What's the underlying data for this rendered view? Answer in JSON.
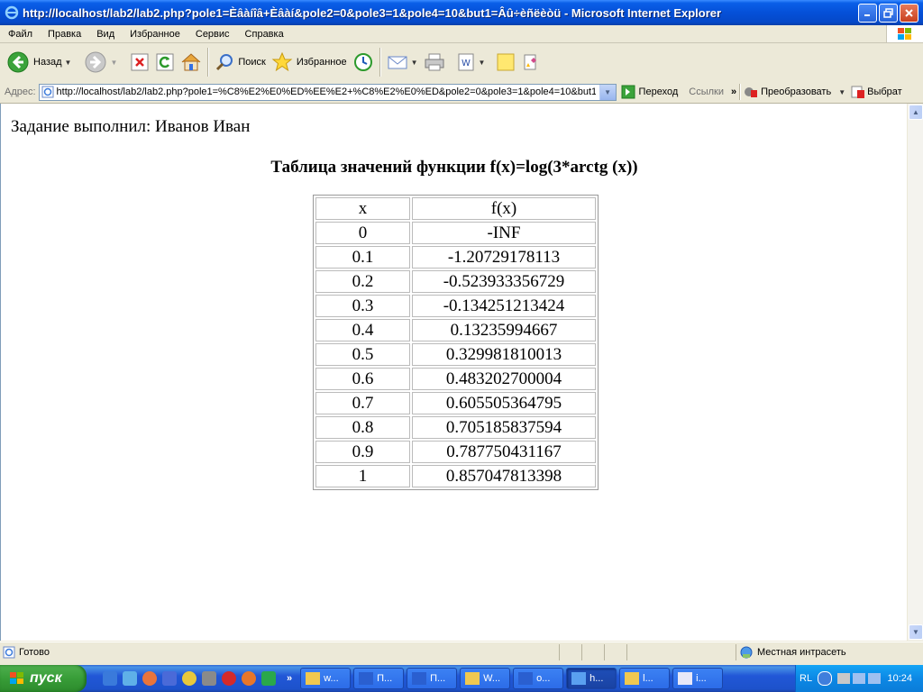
{
  "window": {
    "title": "http://localhost/lab2/lab2.php?pole1=Èâàíîâ+Èâàí&pole2=0&pole3=1&pole4=10&but1=Âû÷èñëèòü - Microsoft Internet Explorer"
  },
  "menu": {
    "items": [
      "Файл",
      "Правка",
      "Вид",
      "Избранное",
      "Сервис",
      "Справка"
    ]
  },
  "toolbar": {
    "back_label": "Назад",
    "search_label": "Поиск",
    "favorites_label": "Избранное"
  },
  "address": {
    "label": "Адрес:",
    "url": "http://localhost/lab2/lab2.php?pole1=%C8%E2%E0%ED%EE%E2+%C8%E2%E0%ED&pole2=0&pole3=1&pole4=10&but1",
    "go_label": "Переход",
    "links_label": "Ссылки",
    "convert_label": "Преобразовать",
    "select_label": "Выбрат"
  },
  "page": {
    "author": "Задание выполнил: Иванов Иван",
    "heading": "Таблица значений функции f(x)=log(3*arctg (x))",
    "table": {
      "headers": [
        "x",
        "f(x)"
      ],
      "rows": [
        [
          "0",
          "-INF"
        ],
        [
          "0.1",
          "-1.20729178113"
        ],
        [
          "0.2",
          "-0.523933356729"
        ],
        [
          "0.3",
          "-0.134251213424"
        ],
        [
          "0.4",
          "0.13235994667"
        ],
        [
          "0.5",
          "0.329981810013"
        ],
        [
          "0.6",
          "0.483202700004"
        ],
        [
          "0.7",
          "0.605505364795"
        ],
        [
          "0.8",
          "0.705185837594"
        ],
        [
          "0.9",
          "0.787750431167"
        ],
        [
          "1",
          "0.857047813398"
        ]
      ]
    }
  },
  "status": {
    "text": "Готово",
    "zone": "Местная интрасеть"
  },
  "taskbar": {
    "start_label": "пуск",
    "tasks": [
      {
        "label": "w...",
        "icon": "folder-icon"
      },
      {
        "label": "П...",
        "icon": "word-icon"
      },
      {
        "label": "П...",
        "icon": "word-icon"
      },
      {
        "label": "W...",
        "icon": "folder-icon"
      },
      {
        "label": "o...",
        "icon": "word-icon"
      },
      {
        "label": "h...",
        "icon": "ie-icon"
      },
      {
        "label": "l...",
        "icon": "folder-icon"
      },
      {
        "label": "i...",
        "icon": "document-icon"
      }
    ],
    "language": "RL",
    "clock": "10:24"
  }
}
